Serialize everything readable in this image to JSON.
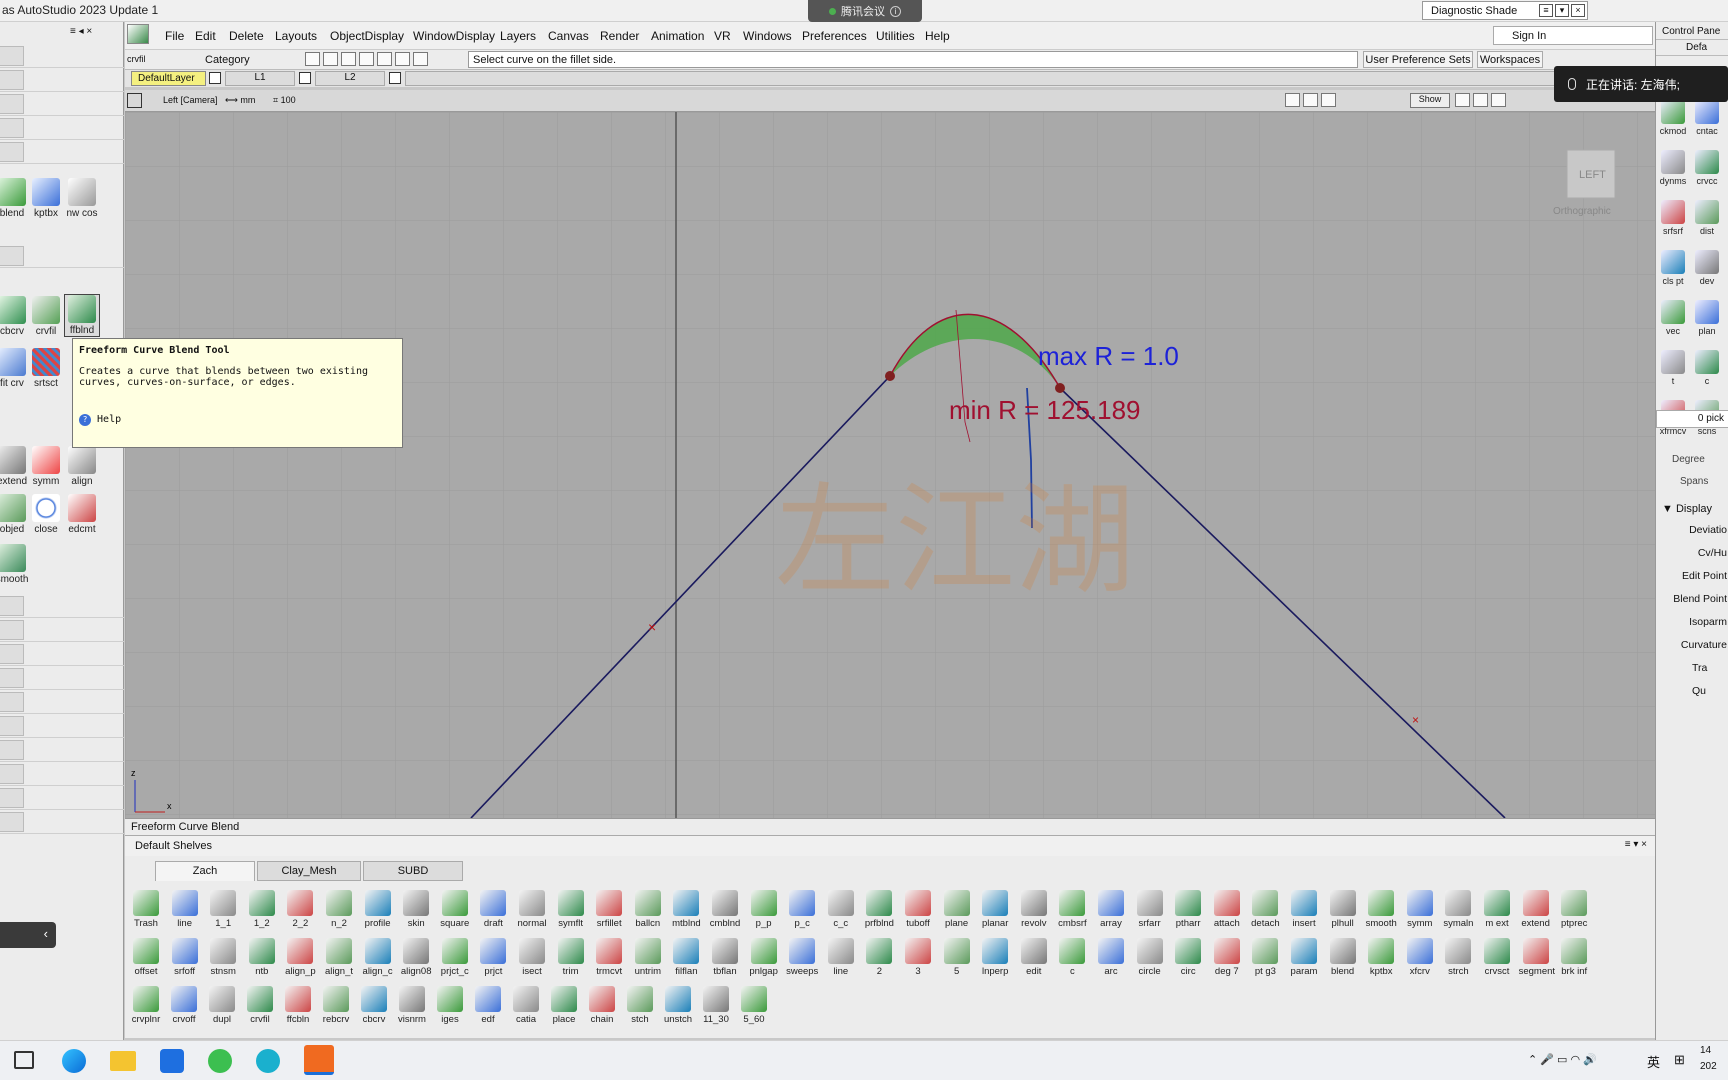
{
  "app": {
    "title": "as AutoStudio 2023 Update 1",
    "meeting": "腾讯会议",
    "diagnostic": "Diagnostic Shade"
  },
  "menu": [
    "File",
    "Edit",
    "Delete",
    "Layouts",
    "ObjectDisplay",
    "WindowDisplay",
    "Layers",
    "Canvas",
    "Render",
    "Animation",
    "VR",
    "Windows",
    "Preferences",
    "Utilities",
    "Help"
  ],
  "current_tool": "crvfil",
  "category_label": "Category",
  "prompt": "Select curve on the fillet side.",
  "prefs_button": "User Preference Sets",
  "workspaces_button": "Workspaces",
  "sign_in": "Sign In",
  "layers": {
    "default": "DefaultLayer",
    "l1": "L1",
    "l2": "L2"
  },
  "viewport": {
    "camera": "Left [Camera]",
    "units": "mm",
    "grid": "100",
    "show": "Show",
    "cube_label": "LEFT",
    "mode": "Orthographic",
    "max_r": "max R = 1.0",
    "min_r": "min R = 125.189",
    "watermark": "左江湖",
    "axis_z": "z",
    "axis_x": "x"
  },
  "tooltip": {
    "title": "Freeform Curve Blend Tool",
    "body": "Creates a curve that blends between two existing curves, curves-on-surface, or edges.",
    "help": "Help"
  },
  "left_tools": [
    "blend",
    "kptbx",
    "nw cos",
    "cbcrv",
    "crvfil",
    "ffblnd",
    "fit crv",
    "srtsct",
    "extend",
    "symm",
    "align",
    "objed",
    "close",
    "edcmt",
    "smooth"
  ],
  "status": "Freeform Curve Blend",
  "shelf_title": "Default Shelves",
  "shelf_tabs": [
    "Zach",
    "Clay_Mesh",
    "SUBD"
  ],
  "shelf_row1": [
    "Trash",
    "line",
    "1_1",
    "1_2",
    "2_2",
    "n_2",
    "profile",
    "skin",
    "square",
    "draft",
    "normal",
    "symflt",
    "srfillet",
    "ballcn",
    "mtblnd",
    "cmblnd",
    "p_p",
    "p_c",
    "c_c",
    "prfblnd",
    "tuboff",
    "plane",
    "planar",
    "revolv",
    "cmbsrf",
    "array",
    "srfarr",
    "ptharr",
    "attach",
    "detach",
    "insert",
    "plhull",
    "smooth",
    "symm",
    "symaln",
    "m ext",
    "extend",
    "ptprec"
  ],
  "shelf_row2": [
    "offset",
    "srfoff",
    "stnsm",
    "ntb",
    "align_p",
    "align_t",
    "align_c",
    "align08",
    "prjct_c",
    "prjct",
    "isect",
    "trim",
    "trmcvt",
    "untrim",
    "filflan",
    "tbflan",
    "pnlgap",
    "sweeps",
    "line",
    "2",
    "3",
    "5",
    "lnperp",
    "edit",
    "c",
    "arc",
    "circle",
    "circ",
    "deg 7",
    "pt g3",
    "param",
    "blend",
    "kptbx",
    "xfcrv",
    "strch",
    "crvsct",
    "segment",
    "brk inf"
  ],
  "shelf_row3": [
    "crvplnr",
    "crvoff",
    "dupl",
    "crvfil",
    "ffcbln",
    "rebcrv",
    "cbcrv",
    "visnrm",
    "iges",
    "edf",
    "catia",
    "place",
    "chain",
    "stch",
    "unstch",
    "11_30",
    "5_60"
  ],
  "right_panel": {
    "title": "Control Pane",
    "defaults": "Defa",
    "tools": [
      "ckmod",
      "cntac",
      "dynms",
      "crvcc",
      "srfsrf",
      "dist",
      "cls pt",
      "dev",
      "vec",
      "plan",
      "t",
      "c",
      "xfrmcv",
      "scns"
    ],
    "picked": "0 pick",
    "degree": "Degree",
    "spans": "Spans",
    "display": "Display",
    "items": [
      "Deviatio",
      "Cv/Hu",
      "Edit Point",
      "Blend Point",
      "Isoparm",
      "Curvature",
      "Tra",
      "Qu"
    ]
  },
  "notification": "正在讲话: 左海伟;",
  "taskbar": {
    "time": "14",
    "date": "202",
    "ime": "英"
  },
  "colors": {
    "viewport_bg": "#a9a9a9",
    "curve": "#1a1a5e",
    "blend_fill": "#4fa84a",
    "max_label": "#1d22d8",
    "min_label": "#a01030"
  }
}
